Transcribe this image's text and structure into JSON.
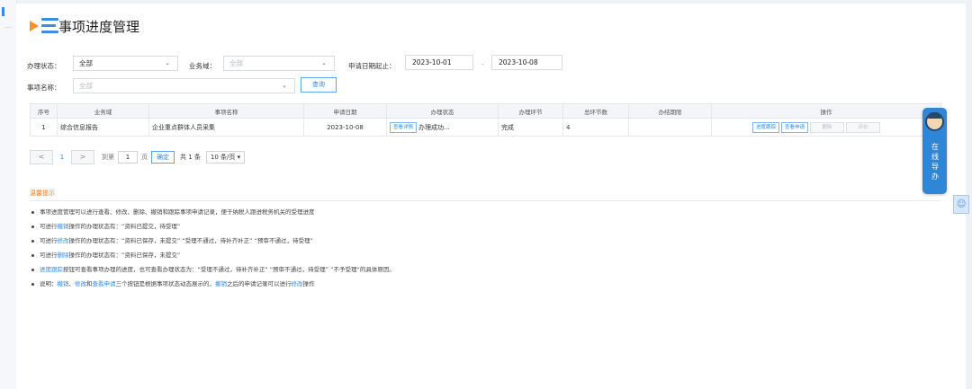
{
  "page": {
    "title": "事项进度管理"
  },
  "filters": {
    "status_label": "办理状态：",
    "status_value": "全部",
    "domain_label": "业务域：",
    "domain_value": "全部",
    "date_label": "申请日期起止：",
    "date_from": "2023-10-01",
    "date_sep": "-",
    "date_to": "2023-10-08",
    "name_label": "事项名称：",
    "name_value": "全部",
    "query_button": "查询"
  },
  "table": {
    "headers": [
      "序号",
      "业务域",
      "事项名称",
      "申请日期",
      "办理状态",
      "办理环节",
      "总环节数",
      "办结期限",
      "操作"
    ],
    "rows": [
      {
        "index": "1",
        "domain": "综合信息报告",
        "item": "企业重点群体人员采集",
        "date": "2023-10-08",
        "detail_button": "查看详情",
        "status": "办理成功...",
        "step": "完成",
        "total": "4",
        "deadline": "",
        "actions": {
          "progress": "进度跟踪",
          "view": "查看申请",
          "delete": "删除",
          "evaluate": "评价"
        }
      }
    ]
  },
  "pager": {
    "prev": "<",
    "current": "1",
    "next": ">",
    "goto_label": "到第",
    "goto_value": "1",
    "page_unit": "页",
    "confirm": "确定",
    "total": "共 1 条",
    "page_size": "10 条/页 ▾"
  },
  "tips": {
    "title": "温馨提示",
    "lines": [
      {
        "plain1": "事项进度管理可以进行查看、修改、删除、撤销和跟踪事项申请记录，便于纳税人跟进税务机关的受理进度"
      },
      {
        "plain1": "可进行",
        "link1": "撤销",
        "plain2": "操作的办理状态有：“资料已提交，待受理”"
      },
      {
        "plain1": "可进行",
        "link1": "修改",
        "plain2": "操作的办理状态有：“资料已保存，未提交”  “受理不通过，待补齐补正”  “预审不通过，待受理”"
      },
      {
        "plain1": "可进行",
        "link1": "删除",
        "plain2": "操作的办理状态有：“资料已保存，未提交”"
      },
      {
        "link1": "进度跟踪",
        "plain2": "按钮可查看事项办理的进度，也可查看办理状态为：“受理不通过，待补齐补正”  “预审不通过，待受理”  “不予受理”的具体原因。"
      },
      {
        "plain1": "说明：",
        "link1": "撤销",
        "plain2": "、",
        "link2": "修改",
        "plain3": "和",
        "link3": "查看申请",
        "plain4": "三个按钮是根据事项状态动态展示的，",
        "link4": "撤销",
        "plain5": "之后的申请记录可以进行",
        "link5": "修改",
        "plain6": "操作"
      }
    ]
  },
  "float_help": {
    "label": "在线导办"
  },
  "colors": {
    "accent": "#2d8be6",
    "warn": "#f07a1a",
    "float": "#2f86d7"
  }
}
